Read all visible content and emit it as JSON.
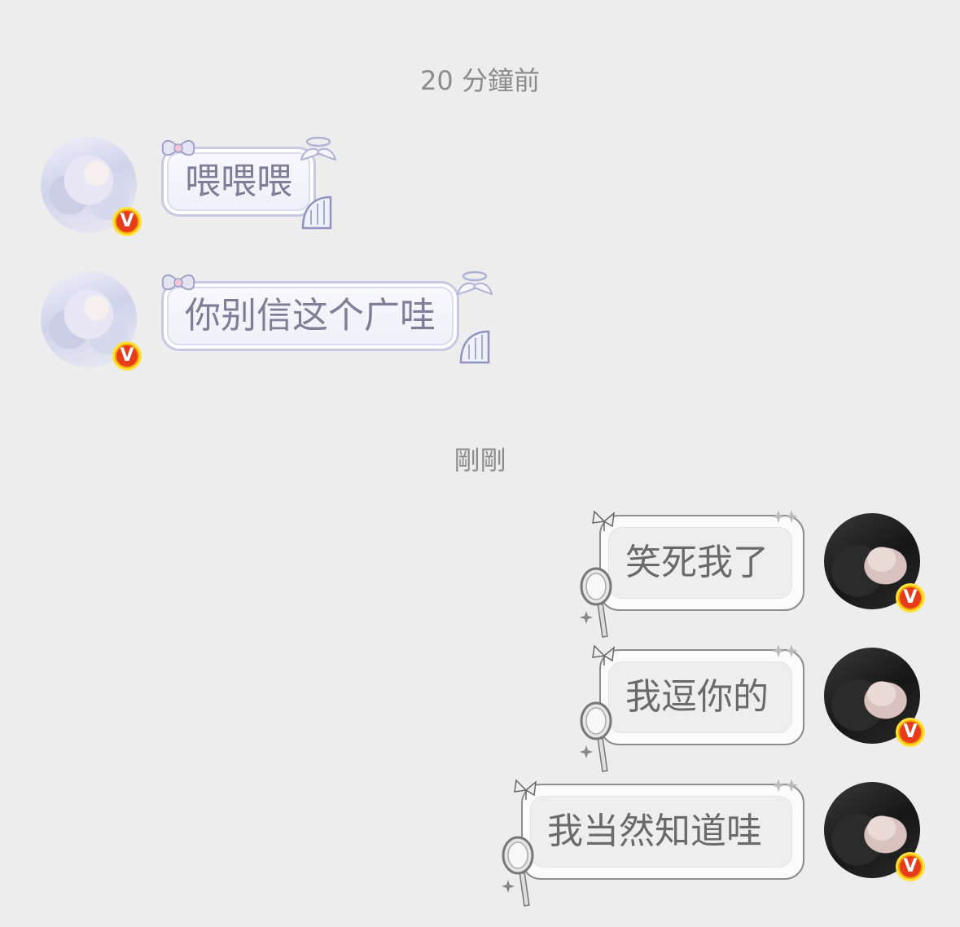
{
  "timestamps": {
    "first": "20 分鐘前",
    "second": "剛剛"
  },
  "messages": [
    {
      "side": "incoming",
      "text": "喂喂喂"
    },
    {
      "side": "incoming",
      "text": "你别信这个广哇"
    },
    {
      "side": "outgoing",
      "text": "笑死我了"
    },
    {
      "side": "outgoing",
      "text": "我逗你的"
    },
    {
      "side": "outgoing",
      "text": "我当然知道哇"
    }
  ],
  "badge": {
    "label": "V"
  },
  "colors": {
    "background": "#ededed",
    "incoming_border": "#c7c9e3",
    "incoming_text": "#7d7f98",
    "outgoing_border": "#8d8d8d",
    "outgoing_text": "#6a6a6a",
    "badge_red": "#e83b1c",
    "badge_yellow": "#ffe13b"
  },
  "icons": {
    "incoming_decor": [
      "bow-icon",
      "angel-wing-icon",
      "harp-icon"
    ],
    "outgoing_decor": [
      "butterfly-icon",
      "sparkle-icon",
      "hand-mirror-icon"
    ],
    "verified": "verified-v-badge-icon"
  }
}
